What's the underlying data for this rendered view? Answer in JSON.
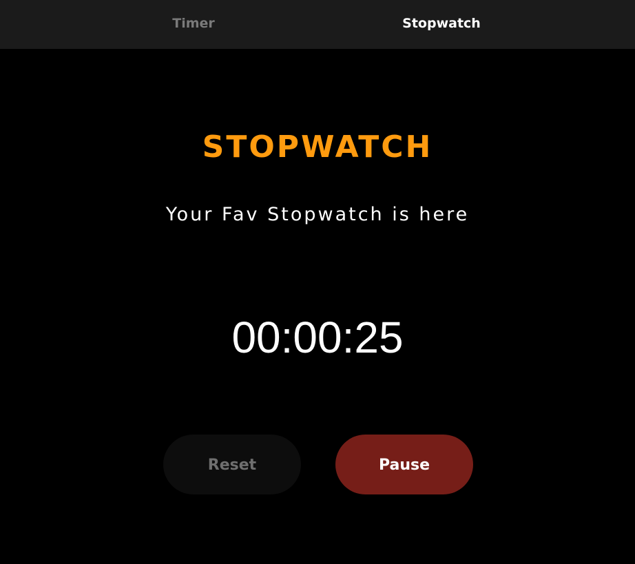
{
  "tabs": {
    "timer": "Timer",
    "stopwatch": "Stopwatch",
    "active": "Stopwatch"
  },
  "main": {
    "title": "STOPWATCH",
    "subtitle": "Your Fav Stopwatch is here",
    "time": "00:00:25"
  },
  "buttons": {
    "reset_label": "Reset",
    "pause_label": "Pause"
  },
  "colors": {
    "background": "#000000",
    "tabbar_background": "#1b1b1b",
    "accent_title": "#ff9b0f",
    "pause_button": "#761e18",
    "reset_button": "#0d0d0d",
    "inactive_tab_text": "#7a7a7a",
    "active_tab_text": "#ffffff"
  }
}
